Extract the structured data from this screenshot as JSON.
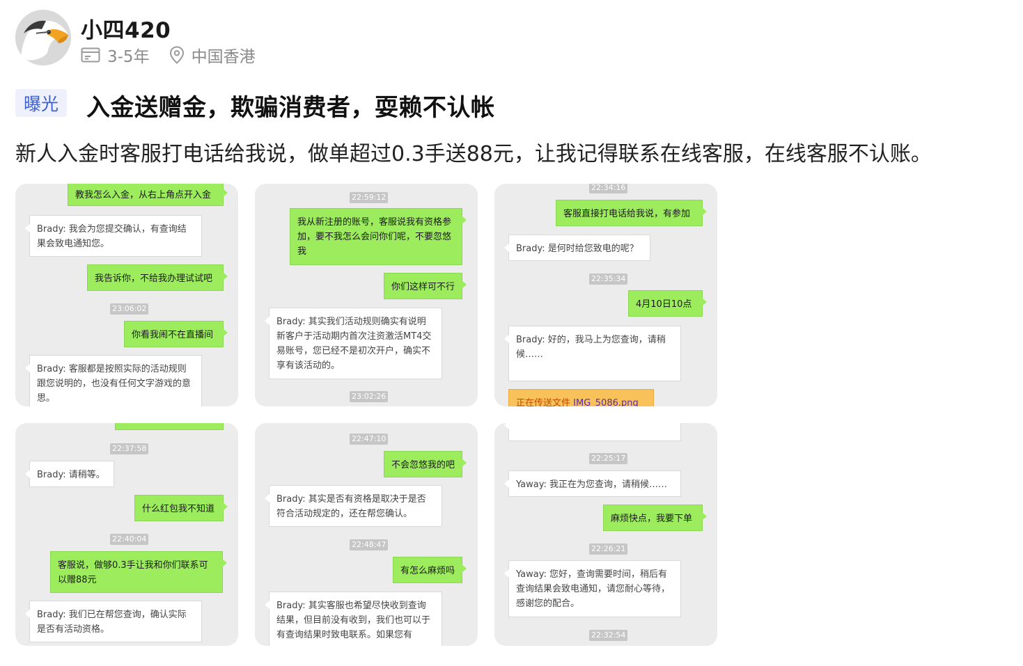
{
  "user": {
    "name": "小四420",
    "experience": "3-5年",
    "location": "中国香港"
  },
  "post": {
    "tag": "曝光",
    "title": "入金送赠金，欺骗消费者，耍赖不认帐",
    "body": "新人入金时客服打电话给我说，做单超过0.3手送88元，让我记得联系在线客服，在线客服不认账。"
  },
  "screenshots": [
    {
      "messages": [
        {
          "type": "sent",
          "text": "教我怎么入金，从右上角点开入金"
        },
        {
          "type": "recv",
          "text": "Brady: 我会为您提交确认，有查询结果会致电通知您。"
        },
        {
          "type": "sent",
          "text": "我告诉你，不给我办理试试吧"
        },
        {
          "type": "time",
          "text": "23:06:02"
        },
        {
          "type": "sent",
          "text": "你看我闹不在直播间"
        },
        {
          "type": "recv",
          "text": "Brady: 客服都是按照实际的活动规则跟您说明的，也没有任何文字游戏的意思。"
        }
      ]
    },
    {
      "messages": [
        {
          "type": "time",
          "text": "22:59:12"
        },
        {
          "type": "sent",
          "text": "我从新注册的账号，客服说我有资格参加，要不我怎么会问你们呢，不要忽悠我"
        },
        {
          "type": "sent",
          "text": "你们这样可不行"
        },
        {
          "type": "recv",
          "text": "Brady: 其实我们活动规则确实有说明新客户于活动期内首次注资激活MT4交易账号，您已经不是初次开户，确实不享有该活动的。"
        },
        {
          "type": "time",
          "text": "23:02:26"
        }
      ]
    },
    {
      "messages": [
        {
          "type": "time",
          "text": "22:34:16"
        },
        {
          "type": "sent",
          "text": "客服直接打电话给我说，有参加"
        },
        {
          "type": "recv",
          "text": "Brady: 是何时给您致电的呢？"
        },
        {
          "type": "time",
          "text": "22:35:34"
        },
        {
          "type": "sent",
          "text": "4月10日10点"
        },
        {
          "type": "recv",
          "text": "Brady: 好的，我马上为您查询，请稍候……"
        },
        {
          "type": "file",
          "text": "正在传送文件",
          "filename": "IMG_5086.png"
        }
      ]
    },
    {
      "messages": [
        {
          "type": "time",
          "text": "22:37:58"
        },
        {
          "type": "recv",
          "text": "Brady: 请稍等。"
        },
        {
          "type": "sent",
          "text": "什么红包我不知道"
        },
        {
          "type": "time",
          "text": "22:40:04"
        },
        {
          "type": "sent",
          "text": "客服说，做够0.3手让我和你们联系可以赠88元"
        },
        {
          "type": "recv",
          "text": "Brady: 我们已在帮您查询，确认实际是否有活动资格。"
        }
      ]
    },
    {
      "messages": [
        {
          "type": "time",
          "text": "22:47:10"
        },
        {
          "type": "sent",
          "text": "不会忽悠我的吧"
        },
        {
          "type": "recv",
          "text": "Brady: 其实是否有资格是取决于是否符合活动规定的，还在帮您确认。"
        },
        {
          "type": "time",
          "text": "22:48:47"
        },
        {
          "type": "sent",
          "text": "有怎么麻烦吗"
        },
        {
          "type": "recv",
          "text": "Brady: 其实客服也希望尽快收到查询结果，但目前没有收到，我们也可以于有查询结果时致电联系。如果您有"
        }
      ]
    },
    {
      "messages": [
        {
          "type": "time",
          "text": "22:25:17"
        },
        {
          "type": "recv",
          "text": "Yaway: 我正在为您查询，请稍候……"
        },
        {
          "type": "sent",
          "text": "麻烦快点，我要下单"
        },
        {
          "type": "time",
          "text": "22:26:21"
        },
        {
          "type": "recv",
          "text": "Yaway: 您好，查询需要时间，稍后有查询结果会致电通知，请您耐心等待，感谢您的配合。"
        },
        {
          "type": "time",
          "text": "22:32:54"
        }
      ]
    }
  ],
  "colors": {
    "tag_bg": "#eef1fb",
    "tag_text": "#3d5fcf",
    "bubble_sent": "#9cec5e",
    "bubble_recv": "#ffffff",
    "chat_bg": "#ececec",
    "file_bubble": "#f9c15a"
  },
  "icons": {
    "experience": "id-card-icon",
    "location": "location-pin-icon",
    "avatar": "eagle-avatar"
  }
}
